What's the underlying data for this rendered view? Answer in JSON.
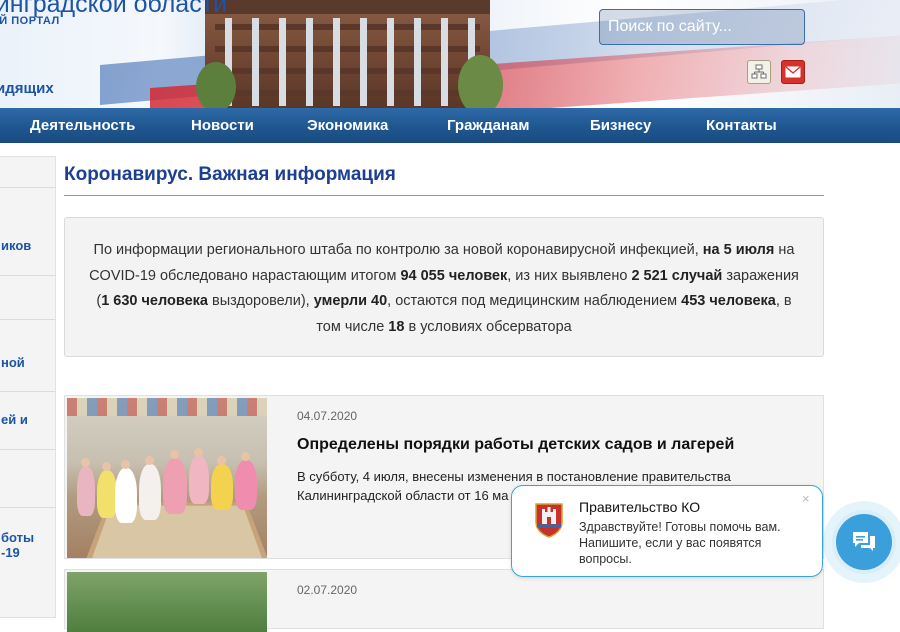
{
  "header": {
    "site_name": "нинградской области",
    "site_subtitle": "ЫЙ ПОРТАЛ",
    "site_tagline": "идящих",
    "search": {
      "placeholder": "Поиск по сайту..."
    },
    "icons": [
      "sitemap-icon",
      "mail-icon"
    ]
  },
  "nav": {
    "items": [
      "Деятельность",
      "Новости",
      "Экономика",
      "Гражданам",
      "Бизнесу",
      "Контакты"
    ]
  },
  "sidebar": {
    "items": [
      "иков",
      "ной",
      "ей и",
      "боты",
      "-19"
    ]
  },
  "main": {
    "title": "Коронавирус. Важная информация",
    "info": {
      "t1": "По информации регионального штаба по контролю за новой коронавирусной инфекцией, ",
      "b1": "на 5 июля",
      "t2": " на COVID-19 обследовано нарастающим итогом ",
      "b2": "94 055 человек",
      "t3": ", из них выявлено  ",
      "b3": "2 521 случай",
      "t4": " заражения (",
      "b4": "1 630 человека",
      "t5": " выздоровели), ",
      "b5": "умерли 40",
      "t6": ", остаются под медицинским наблюдением ",
      "b6": "453 человека",
      "t7": ", в том числе ",
      "b7": "18",
      "t8": " в условиях обсерватора"
    },
    "news": [
      {
        "date": "04.07.2020",
        "title": "Определены порядки работы детских садов и лагерей",
        "text": "В субботу, 4 июля, внесены изменения в постановление правительства Калининградской области от 16 ма"
      },
      {
        "date": "02.07.2020"
      }
    ]
  },
  "chat": {
    "name": "Правительство КО",
    "message": "Здравствуйте! Готовы помочь вам. Напишите, если у вас появятся вопросы.",
    "close": "×"
  },
  "colors": {
    "brand_blue": "#1d54a6",
    "nav_blue": "#1f5690",
    "chat_accent": "#3a9fdb"
  }
}
